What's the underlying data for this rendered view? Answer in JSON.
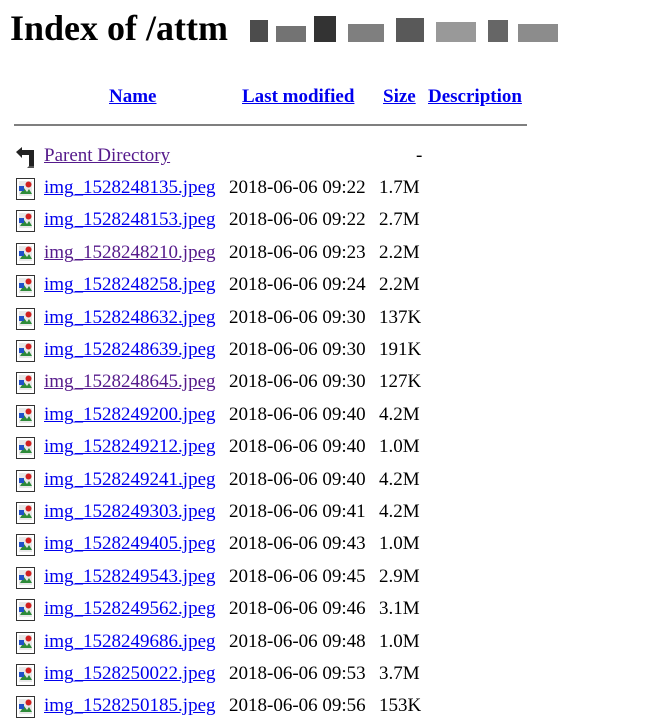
{
  "page": {
    "title": "Index of /attm                      "
  },
  "columns": {
    "name": "Name",
    "last_modified": "Last modified",
    "size": "Size",
    "description": "Description"
  },
  "parent": {
    "label": "Parent Directory",
    "size": "-"
  },
  "files": [
    {
      "name": "img_1528248135.jpeg",
      "modified": "2018-06-06 09:22",
      "size": "1.7M",
      "visited": false
    },
    {
      "name": "img_1528248153.jpeg",
      "modified": "2018-06-06 09:22",
      "size": "2.7M",
      "visited": false
    },
    {
      "name": "img_1528248210.jpeg",
      "modified": "2018-06-06 09:23",
      "size": "2.2M",
      "visited": true
    },
    {
      "name": "img_1528248258.jpeg",
      "modified": "2018-06-06 09:24",
      "size": "2.2M",
      "visited": false
    },
    {
      "name": "img_1528248632.jpeg",
      "modified": "2018-06-06 09:30",
      "size": "137K",
      "visited": false
    },
    {
      "name": "img_1528248639.jpeg",
      "modified": "2018-06-06 09:30",
      "size": "191K",
      "visited": false
    },
    {
      "name": "img_1528248645.jpeg",
      "modified": "2018-06-06 09:30",
      "size": "127K",
      "visited": true
    },
    {
      "name": "img_1528249200.jpeg",
      "modified": "2018-06-06 09:40",
      "size": "4.2M",
      "visited": false
    },
    {
      "name": "img_1528249212.jpeg",
      "modified": "2018-06-06 09:40",
      "size": "1.0M",
      "visited": false
    },
    {
      "name": "img_1528249241.jpeg",
      "modified": "2018-06-06 09:40",
      "size": "4.2M",
      "visited": false
    },
    {
      "name": "img_1528249303.jpeg",
      "modified": "2018-06-06 09:41",
      "size": "4.2M",
      "visited": false
    },
    {
      "name": "img_1528249405.jpeg",
      "modified": "2018-06-06 09:43",
      "size": "1.0M",
      "visited": false
    },
    {
      "name": "img_1528249543.jpeg",
      "modified": "2018-06-06 09:45",
      "size": "2.9M",
      "visited": false
    },
    {
      "name": "img_1528249562.jpeg",
      "modified": "2018-06-06 09:46",
      "size": "3.1M",
      "visited": false
    },
    {
      "name": "img_1528249686.jpeg",
      "modified": "2018-06-06 09:48",
      "size": "1.0M",
      "visited": false
    },
    {
      "name": "img_1528250022.jpeg",
      "modified": "2018-06-06 09:53",
      "size": "3.7M",
      "visited": false
    },
    {
      "name": "img_1528250185.jpeg",
      "modified": "2018-06-06 09:56",
      "size": "153K",
      "visited": false
    }
  ],
  "icons": {
    "parent": "back-arrow-icon",
    "file": "image-file-icon"
  },
  "colors": {
    "link": "#0000ee",
    "visited": "#551a8b",
    "rule": "#7f7f7f"
  }
}
